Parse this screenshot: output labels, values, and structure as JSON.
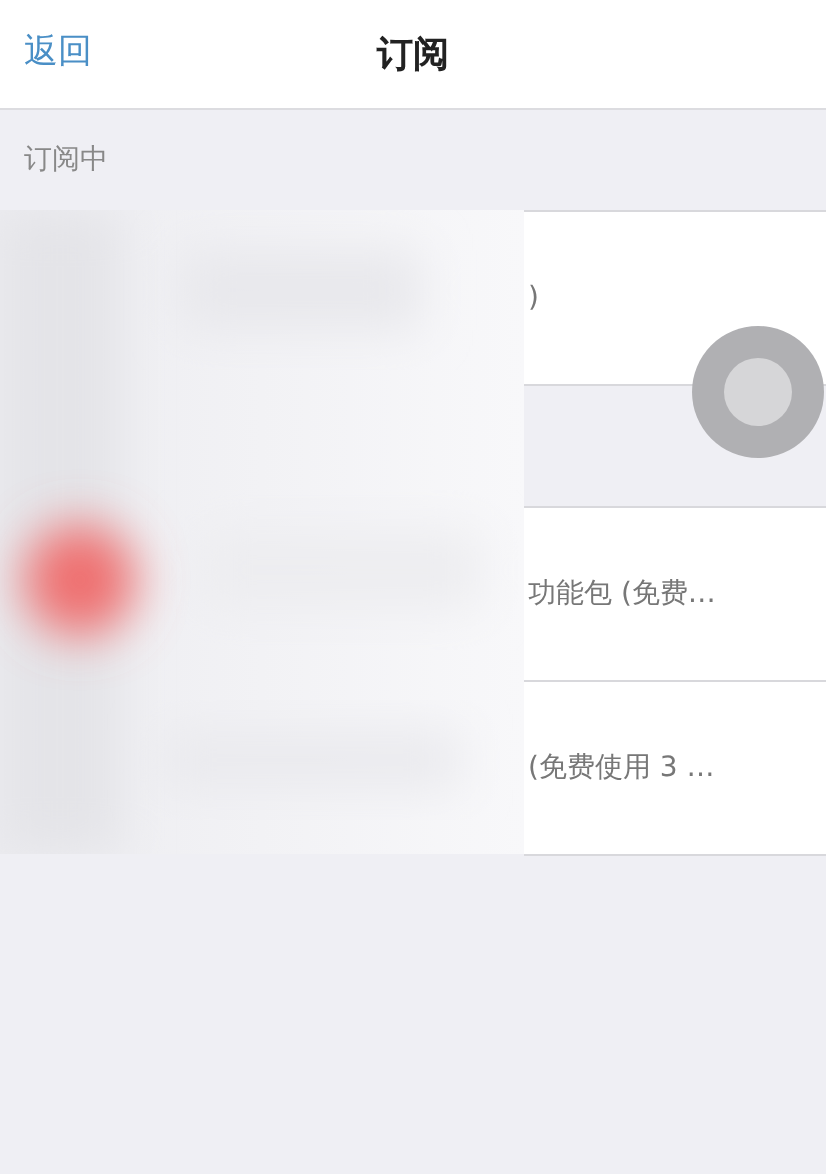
{
  "nav": {
    "back": "返回",
    "title": "订阅"
  },
  "sections": [
    {
      "header": "订阅中",
      "rows": [
        {
          "text": ")"
        }
      ]
    },
    {
      "rows": [
        {
          "text": "功能包 (免费…"
        },
        {
          "text": "(免费使用 3 …"
        }
      ]
    }
  ]
}
